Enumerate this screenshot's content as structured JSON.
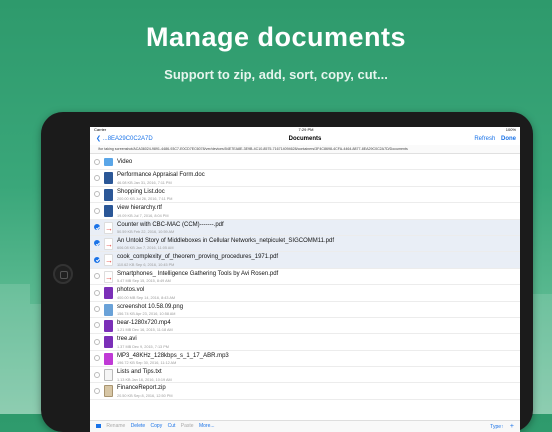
{
  "promo": {
    "headline": "Manage documents",
    "subline": "Support to zip, add, sort, copy, cut..."
  },
  "status_bar": {
    "carrier": "Carrier",
    "time": "7:29 PM",
    "battery": "100%"
  },
  "nav": {
    "back_label": "...8EA29C0C2A7D",
    "title": "Documents",
    "refresh_label": "Refresh",
    "done_label": "Done"
  },
  "path_text": "/for taking screenshot/ACA36024-9891-4486-93C7-E0CD7EC6078/ver/devices/54E7EA8E-3E9B-4C10-8575-716714094628/containers/3F4C8698-4CFA-4464-8877-8EA29C0C2A7D/Documents",
  "files": [
    {
      "name": "Video",
      "meta": "",
      "icon": "folder",
      "selected": false
    },
    {
      "name": "Performance Appraisal Form.doc",
      "meta": "46.08 KB      Jan 31, 2016, 7:11 PM",
      "icon": "doc",
      "selected": false
    },
    {
      "name": "Shopping List.doc",
      "meta": "200.00 KB      Jul 26, 2016, 7:11 PM",
      "icon": "doc",
      "selected": false
    },
    {
      "name": "view hierarchy.rtf",
      "meta": "19.09 KB      Jul 7, 2016, 8:04 PM",
      "icon": "doc",
      "selected": false
    },
    {
      "name": "Counter with CBC-MAC (CCM)-------.pdf",
      "meta": "50.59 KB      Feb 22, 2016, 10:59 AM",
      "icon": "pdf",
      "selected": true
    },
    {
      "name": "An Untold Story of Middleboxes in Cellular Networks_netpiculet_SIGCOMM11.pdf",
      "meta": "606.08 KB      Jan 7, 2016, 11:05 AM",
      "icon": "pdf",
      "selected": true
    },
    {
      "name": "cook_complexity_of_theorem_proving_procedures_1971.pdf",
      "meta": "110.62 KB      Sep 6, 2016, 10:45 PM",
      "icon": "pdf",
      "selected": true
    },
    {
      "name": "Smartphones_ Intelligence Gathering Tools by Avi Rosen.pdf",
      "meta": "5.47 MB      Sep 15, 2015, 8:49 AM",
      "icon": "pdf",
      "selected": false
    },
    {
      "name": "photos.vol",
      "meta": "400.00 MB      Sep 14, 2016, 8:43 AM",
      "icon": "vid",
      "selected": false
    },
    {
      "name": "screenshot 10.58.09.png",
      "meta": "156.74 KB      Apr 23, 2016, 10:58 AM",
      "icon": "img",
      "selected": false
    },
    {
      "name": "bear-1280x720.mp4",
      "meta": "1.21 MB      Dec 16, 2015, 11:18 AM",
      "icon": "vid",
      "selected": false
    },
    {
      "name": "tree.avi",
      "meta": "1.37 MB      Dec 9, 2015, 7:13 PM",
      "icon": "vid",
      "selected": false
    },
    {
      "name": "MP3_48KHz_128kbps_s_1_17_ABR.mp3",
      "meta": "196.72 KB      Sep 30, 2016, 11:12 AM",
      "icon": "mp3",
      "selected": false
    },
    {
      "name": "Lists and Tips.txt",
      "meta": "1.13 KB      Jan 16, 2016, 10:19 AM",
      "icon": "txt",
      "selected": false
    },
    {
      "name": "FinanceReport.zip",
      "meta": "20.50 KB      Sep 8, 2016, 12:50 PM",
      "icon": "zip",
      "selected": false
    }
  ],
  "toolbar": {
    "rename": "Rename",
    "delete": "Delete",
    "copy": "Copy",
    "cut": "Cut",
    "paste": "Paste",
    "more": "More...",
    "sort": "Type↑",
    "add": "+"
  }
}
